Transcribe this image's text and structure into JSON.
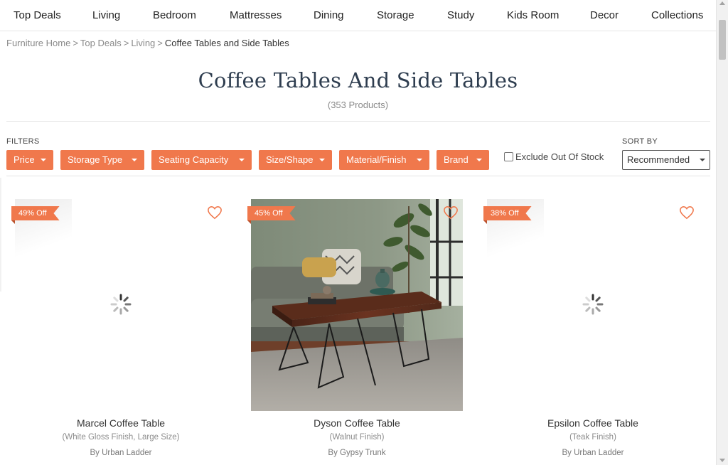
{
  "nav": {
    "items": [
      "Top Deals",
      "Living",
      "Bedroom",
      "Mattresses",
      "Dining",
      "Storage",
      "Study",
      "Kids Room",
      "Decor",
      "Collections"
    ]
  },
  "breadcrumb": {
    "items": [
      "Furniture Home",
      "Top Deals",
      "Living"
    ],
    "separator": ">",
    "current": "Coffee Tables and Side Tables"
  },
  "page": {
    "title": "Coffee Tables And Side Tables",
    "count": "(353 Products)"
  },
  "filters": {
    "label": "FILTERS",
    "buttons": [
      "Price",
      "Storage Type",
      "Seating Capacity",
      "Size/Shape",
      "Material/Finish",
      "Brand"
    ],
    "exclude_label": "Exclude Out Of Stock",
    "exclude_checked": false
  },
  "sort": {
    "label": "SORT BY",
    "selected": "Recommended"
  },
  "products": [
    {
      "badge": "49% Off",
      "name": "Marcel Coffee Table",
      "variant": "(White Gloss Finish, Large Size)",
      "brand": "By Urban Ladder",
      "image_loaded": false
    },
    {
      "badge": "45% Off",
      "name": "Dyson Coffee Table",
      "variant": "(Walnut Finish)",
      "brand": "By Gypsy Trunk",
      "image_loaded": true
    },
    {
      "badge": "38% Off",
      "name": "Epsilon Coffee Table",
      "variant": "(Teak Finish)",
      "brand": "By Urban Ladder",
      "image_loaded": false
    }
  ],
  "colors": {
    "accent": "#f0784c",
    "title": "#2e3d4f",
    "muted": "#8a8a8a"
  }
}
